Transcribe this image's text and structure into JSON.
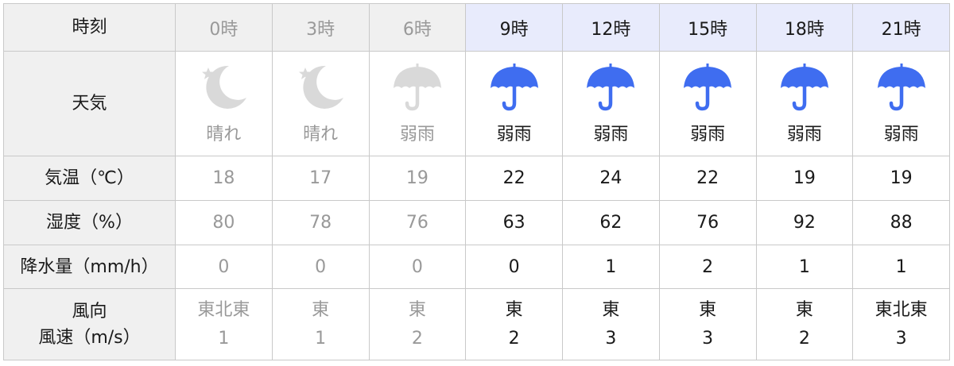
{
  "labels": {
    "time": "時刻",
    "weather": "天気",
    "temperature": "気温（℃）",
    "humidity": "湿度（%）",
    "precipitation": "降水量（mm/h）",
    "wind_direction": "風向",
    "wind_speed": "風速（m/s）"
  },
  "colors": {
    "past_text": "#999999",
    "future_text": "#1a1a1a",
    "future_header_bg": "#e8ebfc",
    "label_bg": "#f0f0f0",
    "umbrella_blue": "#3f6df0",
    "past_icon_gray": "#d9d9d9",
    "border": "#c9c9c9"
  },
  "hours": [
    {
      "time": "0時",
      "past": true,
      "icon": "moon-icon",
      "weather": "晴れ",
      "temp": "18",
      "humidity": "80",
      "precip": "0",
      "wind_dir": "東北東",
      "wind_speed": "1"
    },
    {
      "time": "3時",
      "past": true,
      "icon": "moon-icon",
      "weather": "晴れ",
      "temp": "17",
      "humidity": "78",
      "precip": "0",
      "wind_dir": "東",
      "wind_speed": "1"
    },
    {
      "time": "6時",
      "past": true,
      "icon": "umbrella-icon",
      "weather": "弱雨",
      "temp": "19",
      "humidity": "76",
      "precip": "0",
      "wind_dir": "東",
      "wind_speed": "2"
    },
    {
      "time": "9時",
      "past": false,
      "icon": "umbrella-icon",
      "weather": "弱雨",
      "temp": "22",
      "humidity": "63",
      "precip": "0",
      "wind_dir": "東",
      "wind_speed": "2"
    },
    {
      "time": "12時",
      "past": false,
      "icon": "umbrella-icon",
      "weather": "弱雨",
      "temp": "24",
      "humidity": "62",
      "precip": "1",
      "wind_dir": "東",
      "wind_speed": "3"
    },
    {
      "time": "15時",
      "past": false,
      "icon": "umbrella-icon",
      "weather": "弱雨",
      "temp": "22",
      "humidity": "76",
      "precip": "2",
      "wind_dir": "東",
      "wind_speed": "3"
    },
    {
      "time": "18時",
      "past": false,
      "icon": "umbrella-icon",
      "weather": "弱雨",
      "temp": "19",
      "humidity": "92",
      "precip": "1",
      "wind_dir": "東",
      "wind_speed": "2"
    },
    {
      "time": "21時",
      "past": false,
      "icon": "umbrella-icon",
      "weather": "弱雨",
      "temp": "19",
      "humidity": "88",
      "precip": "1",
      "wind_dir": "東北東",
      "wind_speed": "3"
    }
  ]
}
